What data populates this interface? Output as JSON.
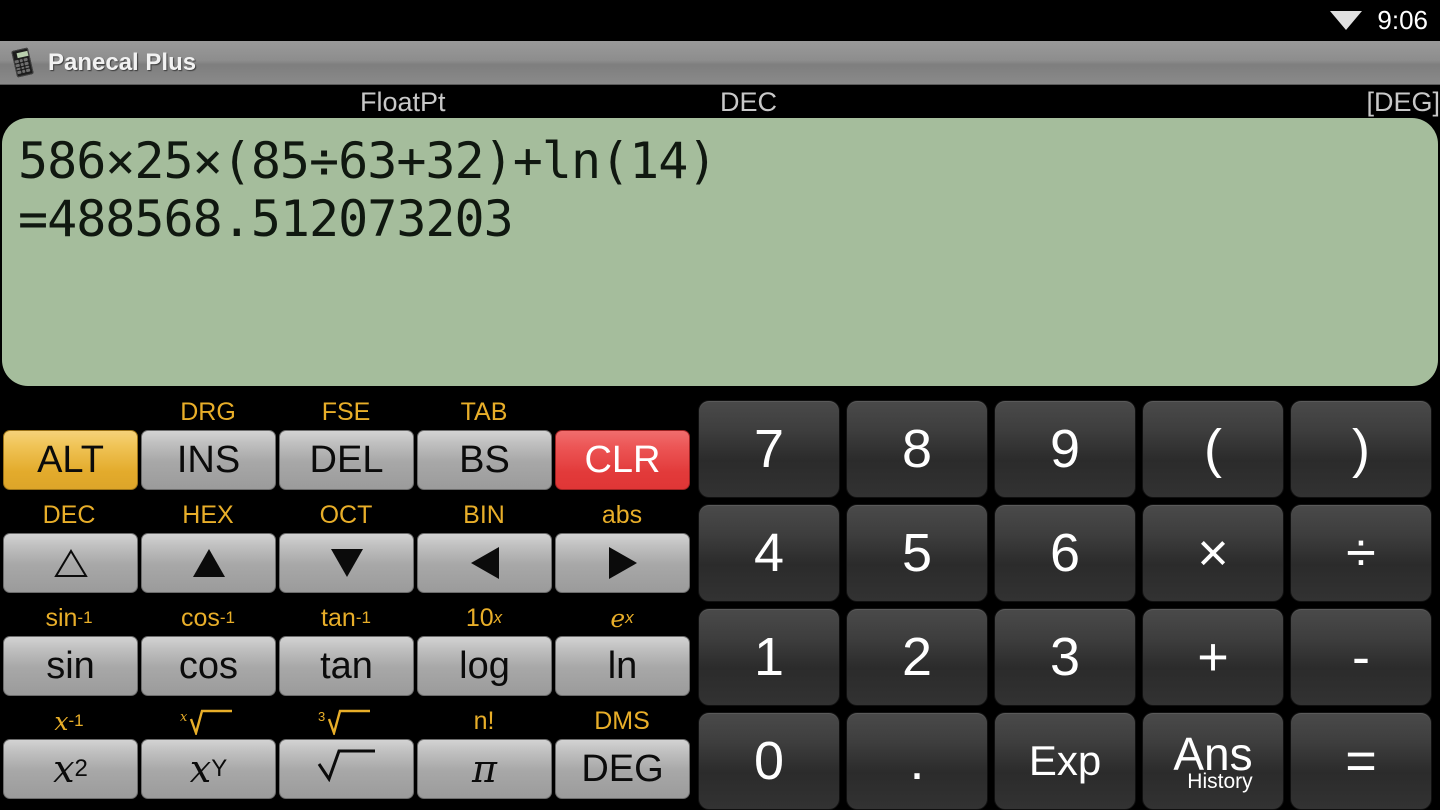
{
  "status_bar": {
    "wifi_icon": "wifi-icon",
    "time": "9:06"
  },
  "title_bar": {
    "icon": "calculator-icon",
    "title": "Panecal Plus"
  },
  "mode_bar": {
    "notation": "FloatPt",
    "base": "DEC",
    "angle": "[DEG]"
  },
  "display": {
    "expression": "586×25×(85÷63+32)+ln(14)",
    "result": "=488568.512073203",
    "background_color": "#a5bd9c",
    "text_color": "#101810"
  },
  "colors": {
    "alt_key": "#e3ab2c",
    "clr_key": "#e23a3a",
    "alt_label": "#e8ae29",
    "silver_key": "#b4b4b4",
    "dark_key": "#343434"
  },
  "keypad_left": {
    "rows": [
      {
        "labels": [
          "",
          "DRG",
          "FSE",
          "TAB",
          ""
        ],
        "keys": [
          {
            "label": "ALT",
            "style": "alt"
          },
          {
            "label": "INS",
            "style": "silver"
          },
          {
            "label": "DEL",
            "style": "silver"
          },
          {
            "label": "BS",
            "style": "silver"
          },
          {
            "label": "CLR",
            "style": "clr"
          }
        ]
      },
      {
        "labels": [
          "DEC",
          "HEX",
          "OCT",
          "BIN",
          "abs"
        ],
        "keys": [
          {
            "label": "",
            "icon": "triangle-up-outline-icon",
            "style": "silver"
          },
          {
            "label": "",
            "icon": "triangle-up-icon",
            "style": "silver"
          },
          {
            "label": "",
            "icon": "triangle-down-icon",
            "style": "silver"
          },
          {
            "label": "",
            "icon": "triangle-left-icon",
            "style": "silver"
          },
          {
            "label": "",
            "icon": "triangle-right-icon",
            "style": "silver"
          }
        ]
      },
      {
        "labels": [
          "sin-1",
          "cos-1",
          "tan-1",
          "10x",
          "ex"
        ],
        "keys": [
          {
            "label": "sin",
            "style": "silver"
          },
          {
            "label": "cos",
            "style": "silver"
          },
          {
            "label": "tan",
            "style": "silver"
          },
          {
            "label": "log",
            "style": "silver"
          },
          {
            "label": "ln",
            "style": "silver"
          }
        ]
      },
      {
        "labels": [
          "x-1",
          "x-root",
          "cube-root",
          "n!",
          "DMS"
        ],
        "keys": [
          {
            "label": "x2",
            "style": "silver"
          },
          {
            "label": "xY",
            "style": "silver"
          },
          {
            "label": "sqrt",
            "style": "silver"
          },
          {
            "label": "π",
            "style": "silver"
          },
          {
            "label": "DEG",
            "style": "silver"
          }
        ]
      }
    ],
    "label_text": {
      "r0": [
        "",
        "DRG",
        "FSE",
        "TAB",
        ""
      ],
      "r1": [
        "DEC",
        "HEX",
        "OCT",
        "BIN",
        "abs"
      ],
      "r2": [
        "sin",
        "cos",
        "tan",
        "10",
        "e"
      ],
      "r2sup": [
        "-1",
        "-1",
        "-1",
        "x",
        "x"
      ],
      "r3": [
        "x",
        "",
        "",
        "n!",
        "DMS"
      ],
      "r3sup": [
        "-1",
        "",
        "",
        "",
        ""
      ]
    },
    "key_text": {
      "r0": [
        "ALT",
        "INS",
        "DEL",
        "BS",
        "CLR"
      ],
      "r2": [
        "sin",
        "cos",
        "tan",
        "log",
        "ln"
      ],
      "r3": [
        "x",
        "x",
        "",
        "π",
        "DEG"
      ],
      "r3sup": [
        "2",
        "Y",
        "",
        "",
        ""
      ]
    }
  },
  "keypad_right": {
    "rows": [
      [
        "7",
        "8",
        "9",
        "(",
        ")"
      ],
      [
        "4",
        "5",
        "6",
        "×",
        "÷"
      ],
      [
        "1",
        "2",
        "3",
        "+",
        "-"
      ],
      [
        "0",
        ".",
        "Exp",
        "Ans",
        "="
      ]
    ],
    "ans_sublabel": "History"
  }
}
